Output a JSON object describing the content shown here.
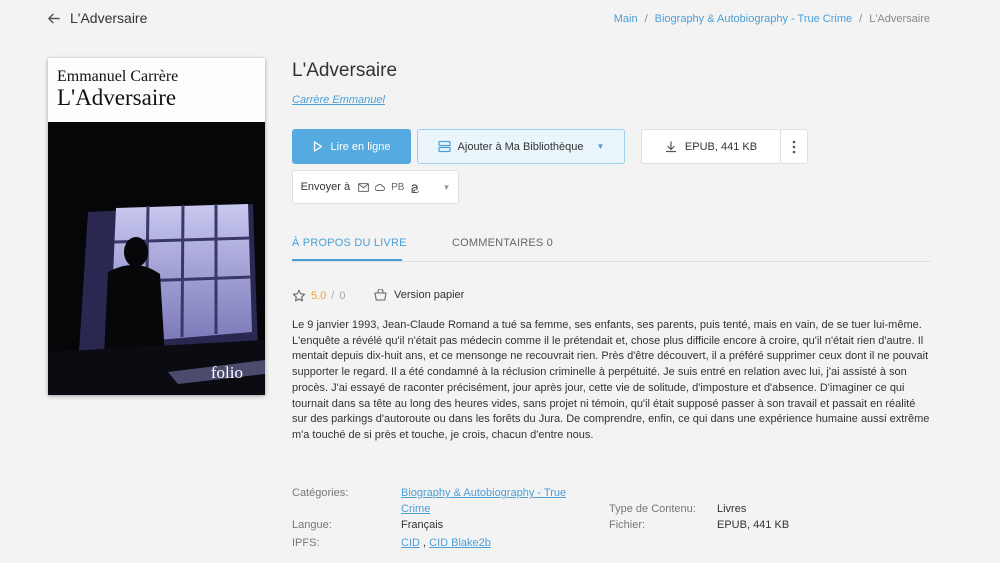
{
  "header": {
    "back_title": "L'Adversaire",
    "breadcrumb": [
      "Main",
      "Biography & Autobiography - True Crime",
      "L'Adversaire"
    ]
  },
  "cover": {
    "author": "Emmanuel Carrère",
    "title": "L'Adversaire",
    "publisher_mark": "folio"
  },
  "book": {
    "title": "L'Adversaire",
    "author": "Carrère Emmanuel"
  },
  "actions": {
    "read_online": "Lire en ligne",
    "add_library": "Ajouter à Ma Bibliothèque",
    "download": "EPUB, 441 KB",
    "send_to": "Envoyer à",
    "send_pb": "PB"
  },
  "tabs": [
    {
      "label": "À PROPOS DU LIVRE"
    },
    {
      "label": "COMMENTAIRES 0"
    }
  ],
  "rating": {
    "score": "5.0",
    "separator": "/",
    "max": "0"
  },
  "paper_version": "Version papier",
  "description": "Le 9 janvier 1993, Jean-Claude Romand a tué sa femme, ses enfants, ses parents, puis tenté, mais en vain, de se tuer lui-même. L'enquête a révélé qu'il n'était pas médecin comme il le prétendait et, chose plus difficile encore à croire, qu'il n'était rien d'autre. Il mentait depuis dix-huit ans, et ce mensonge ne recouvrait rien. Près d'être découvert, il a préféré supprimer ceux dont il ne pouvait supporter le regard. Il a été condamné à la réclusion criminelle à perpétuité. Je suis entré en relation avec lui, j'ai assisté à son procès. J'ai essayé de raconter précisément, jour après jour, cette vie de solitude, d'imposture et d'absence. D'imaginer ce qui tournait dans sa tête au long des heures vides, sans projet ni témoin, qu'il était supposé passer à son travail et passait en réalité sur des parkings d'autoroute ou dans les forêts du Jura. De comprendre, enfin, ce qui dans une expérience humaine aussi extrême m'a touché de si près et touche, je crois, chacun d'entre nous.",
  "details": {
    "categories_label": "Catégories:",
    "categories_value_line1": "Biography & Autobiography - True",
    "categories_value_line2": "Crime",
    "language_label": "Langue:",
    "language_value": "Français",
    "ipfs_label": "IPFS:",
    "ipfs_cid": "CID",
    "ipfs_sep": ",",
    "ipfs_blake": "CID Blake2b",
    "content_type_label": "Type de Contenu:",
    "content_type_value": "Livres",
    "file_label": "Fichier:",
    "file_value": "EPUB, 441 KB"
  },
  "colors": {
    "accent": "#4a9fd8",
    "primary_button": "#55aadf",
    "rating": "#e8a33d",
    "background": "#f3f3f3"
  }
}
